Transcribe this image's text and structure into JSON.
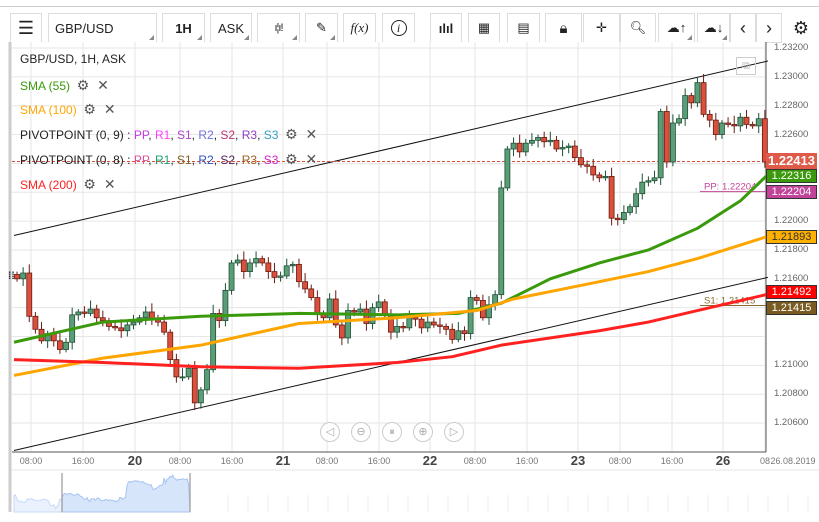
{
  "toolbar": {
    "menu_icon": "hamburger-icon",
    "symbol": "GBP/USD",
    "timeframe": "1H",
    "price_type": "ASK",
    "buttons": [
      "chart-type-icon",
      "draw-icon",
      "function-icon",
      "info-icon",
      "volume-bars-icon",
      "calendar-icon",
      "news-icon",
      "lock-icon",
      "crosshair-icon",
      "zoom-search-icon",
      "upload-cloud-icon",
      "download-cloud-icon",
      "chevron-left-icon",
      "chevron-right-icon",
      "gear-icon"
    ],
    "fx_label": "f(x)"
  },
  "legend": {
    "title": "GBP/USD, 1H, ASK",
    "sma55": {
      "label": "SMA (55)",
      "color": "#3a9a0c"
    },
    "sma100": {
      "label": "SMA (100)",
      "color": "#ffa500"
    },
    "sma200": {
      "label": "SMA (200)",
      "color": "#ff2020"
    },
    "pivot1": {
      "label": "PIVOTPOINT (0, 9)",
      "items": [
        [
          "PP",
          "#c040e0"
        ],
        [
          "R1",
          "#ff40ff"
        ],
        [
          "S1",
          "#b040d0"
        ],
        [
          "R2",
          "#7070e0"
        ],
        [
          "S2",
          "#c03070"
        ],
        [
          "R3",
          "#9040c0"
        ],
        [
          "S3",
          "#30a0c0"
        ]
      ]
    },
    "pivot2": {
      "label": "PIVOTPOINT (0, 8)",
      "items": [
        [
          "PP",
          "#e050a0"
        ],
        [
          "R1",
          "#20a070"
        ],
        [
          "S1",
          "#806020"
        ],
        [
          "R2",
          "#3050c0"
        ],
        [
          "S2",
          "#502050"
        ],
        [
          "R3",
          "#a06020"
        ],
        [
          "S3",
          "#d020d0"
        ]
      ]
    }
  },
  "price_axis": {
    "ticks": [
      "1.23200",
      "1.23000",
      "1.22800",
      "1.22600",
      "1.22000",
      "1.21800",
      "1.21600",
      "1.21000",
      "1.20800",
      "1.20600"
    ],
    "tick_values": [
      1.232,
      1.23,
      1.228,
      1.226,
      1.22,
      1.218,
      1.216,
      1.21,
      1.208,
      1.206
    ],
    "labels": [
      {
        "text": "1.22413",
        "value": 1.22413,
        "bg": "#df5a48",
        "fg": "#ffffff"
      },
      {
        "text": "1.22316",
        "value": 1.22316,
        "bg": "#3a9a0c",
        "fg": "#ffffff"
      },
      {
        "text": "1.22204",
        "value": 1.22204,
        "bg": "#c2449a",
        "fg": "#ffffff"
      },
      {
        "text": "1.21893",
        "value": 1.21893,
        "bg": "#ffb000",
        "fg": "#333333"
      },
      {
        "text": "1.21492",
        "value": 1.21492,
        "bg": "#ff0000",
        "fg": "#ffffff"
      },
      {
        "text": "1.21415",
        "value": 1.21415,
        "bg": "#7a5c22",
        "fg": "#ffffff"
      }
    ]
  },
  "pivot_lines": [
    {
      "text": "PP: 1.22204",
      "value": 1.22204,
      "color": "#c2449a"
    },
    {
      "text": "S1: 1.21415",
      "value": 1.21415,
      "color": "#8a6a30"
    }
  ],
  "time_axis": {
    "ticks": [
      [
        "08:00",
        0
      ],
      [
        "16:00",
        0
      ],
      [
        "20",
        1
      ],
      [
        "08:00",
        0
      ],
      [
        "16:00",
        0
      ],
      [
        "21",
        1
      ],
      [
        "08:00",
        0
      ],
      [
        "16:00",
        0
      ],
      [
        "22",
        1
      ],
      [
        "08:00",
        0
      ],
      [
        "16:00",
        0
      ],
      [
        "23",
        1
      ],
      [
        "08:00",
        0
      ],
      [
        "16:00",
        0
      ],
      [
        "26",
        1
      ],
      [
        "08",
        0
      ]
    ],
    "last": "26.08.2019"
  },
  "nav_buttons": [
    "arrow-left-icon",
    "zoom-out-icon",
    "reset-icon",
    "zoom-in-icon",
    "arrow-right-icon"
  ],
  "chart_data": {
    "type": "candlestick",
    "title": "GBP/USD, 1H, ASK",
    "current_price": 1.22413,
    "closes": [
      1.216,
      1.2164,
      1.2134,
      1.2125,
      1.2117,
      1.2122,
      1.2117,
      1.2111,
      1.2116,
      1.2135,
      1.2137,
      1.2136,
      1.2139,
      1.2133,
      1.2131,
      1.2127,
      1.2126,
      1.2124,
      1.2128,
      1.213,
      1.2133,
      1.2137,
      1.2132,
      1.213,
      1.2123,
      1.2104,
      1.2092,
      1.2092,
      1.2098,
      1.2074,
      1.2083,
      1.2097,
      1.2136,
      1.2131,
      1.2152,
      1.2171,
      1.2173,
      1.2165,
      1.2171,
      1.2174,
      1.2171,
      1.2165,
      1.2161,
      1.2162,
      1.2169,
      1.217,
      1.2158,
      1.2153,
      1.2147,
      1.2136,
      1.2133,
      1.2146,
      1.2128,
      1.2119,
      1.2138,
      1.2137,
      1.2139,
      1.2129,
      1.214,
      1.2144,
      1.2135,
      1.2123,
      1.2127,
      1.2126,
      1.2133,
      1.2132,
      1.2126,
      1.213,
      1.2128,
      1.2127,
      1.2125,
      1.2118,
      1.2124,
      1.2122,
      1.2147,
      1.2145,
      1.2133,
      1.2142,
      1.2149,
      1.2223,
      1.225,
      1.2254,
      1.2248,
      1.2254,
      1.2256,
      1.2258,
      1.2255,
      1.2256,
      1.225,
      1.2251,
      1.2252,
      1.2244,
      1.2239,
      1.2238,
      1.2232,
      1.223,
      1.2231,
      1.2202,
      1.2201,
      1.2206,
      1.221,
      1.2219,
      1.2227,
      1.2228,
      1.223,
      1.2276,
      1.2241,
      1.2268,
      1.2271,
      1.2287,
      1.2282,
      1.2296,
      1.2274,
      1.227,
      1.226,
      1.2268,
      1.2267,
      1.2266,
      1.2272,
      1.2267,
      1.2266,
      1.2271,
      1.2241
    ],
    "sma55": [
      [
        0,
        1.2116
      ],
      [
        14,
        1.213
      ],
      [
        30,
        1.2134
      ],
      [
        46,
        1.2136
      ],
      [
        62,
        1.2135
      ],
      [
        72,
        1.2136
      ],
      [
        79,
        1.2143
      ],
      [
        87,
        1.216
      ],
      [
        95,
        1.2171
      ],
      [
        103,
        1.218
      ],
      [
        111,
        1.2195
      ],
      [
        118,
        1.2214
      ],
      [
        122,
        1.2231
      ]
    ],
    "sma100": [
      [
        0,
        1.2093
      ],
      [
        14,
        1.2105
      ],
      [
        30,
        1.2114
      ],
      [
        46,
        1.2129
      ],
      [
        62,
        1.2133
      ],
      [
        75,
        1.2138
      ],
      [
        81,
        1.2146
      ],
      [
        95,
        1.2158
      ],
      [
        103,
        1.2165
      ],
      [
        111,
        1.2174
      ],
      [
        122,
        1.2189
      ]
    ],
    "sma200": [
      [
        0,
        1.2104
      ],
      [
        14,
        1.2102
      ],
      [
        30,
        1.2099
      ],
      [
        46,
        1.2098
      ],
      [
        62,
        1.2102
      ],
      [
        71,
        1.2106
      ],
      [
        79,
        1.2114
      ],
      [
        95,
        1.2124
      ],
      [
        103,
        1.213
      ],
      [
        111,
        1.2138
      ],
      [
        122,
        1.2149
      ]
    ],
    "trendlines": [
      [
        [
          -0.5,
          1.219
        ],
        [
          122.5,
          1.2311
        ]
      ],
      [
        [
          -0.5,
          1.2041
        ],
        [
          122.5,
          1.2161
        ]
      ]
    ],
    "colors": {
      "up": "#5a9e78",
      "down": "#d9503c"
    }
  }
}
